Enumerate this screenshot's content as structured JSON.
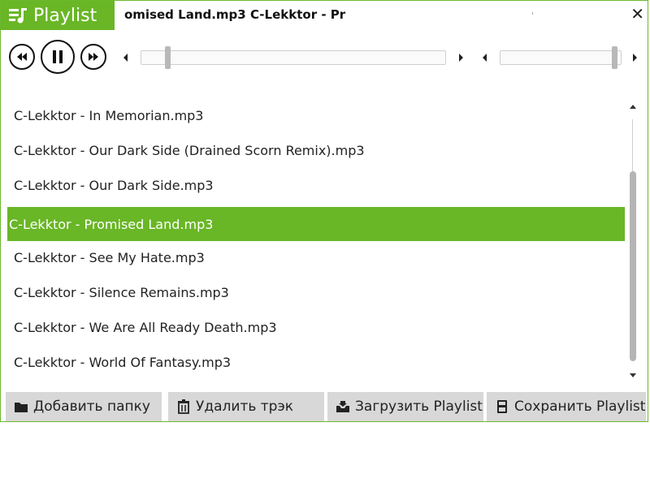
{
  "header": {
    "tab_label": "Playlist",
    "now_playing": "omised Land.mp3 C-Lekktor - Pr",
    "close_glyph": "✕"
  },
  "playlist": {
    "items": [
      {
        "label": "C-Lekktor - In Memorian.mp3"
      },
      {
        "label": "C-Lekktor - Our Dark Side (Drained Scorn Remix).mp3"
      },
      {
        "label": "C-Lekktor - Our Dark Side.mp3"
      },
      {
        "label": "C-Lekktor - Promised Land.mp3"
      },
      {
        "label": "C-Lekktor - See My Hate.mp3"
      },
      {
        "label": "C-Lekktor - Silence Remains.mp3"
      },
      {
        "label": "C-Lekktor - We Are All Ready Death.mp3"
      },
      {
        "label": "C-Lekktor - World Of Fantasy.mp3"
      }
    ],
    "selected_index": 3
  },
  "seek": {
    "position_fraction": 0.08
  },
  "volume": {
    "level_fraction": 0.97
  },
  "footer": {
    "add_folder": "Добавить папку",
    "delete_track": "Удалить трэк",
    "load_playlist": "Загрузить Playlist",
    "save_playlist": "Сохранить Playlist"
  },
  "theme": {
    "accent": "#69b626"
  }
}
